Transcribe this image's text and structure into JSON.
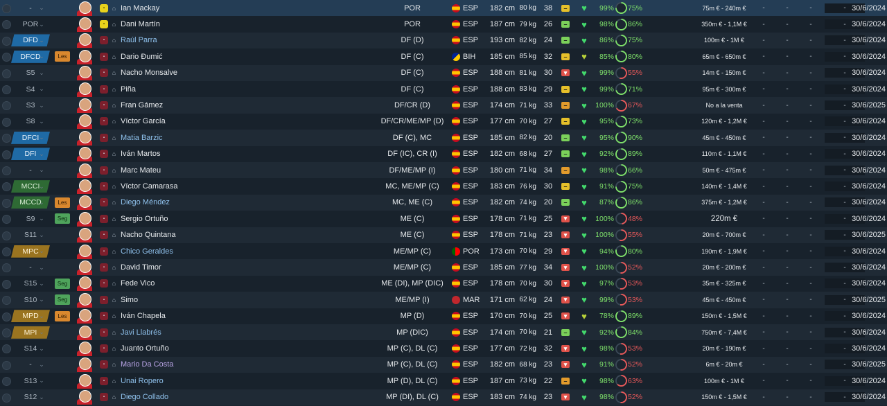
{
  "colors": {
    "condition_good": "#7ee06a",
    "sharpness_high": "#7ee06a",
    "sharpness_low": "#e8595a",
    "link_name": "#8fc1ec",
    "loan_name": "#b9a4e6"
  },
  "players": [
    {
      "pos": "-",
      "pos_style": "none",
      "role": "",
      "name": "Ian Mackay",
      "name_style": "normal",
      "shirt": "yellow",
      "position": "POR",
      "nat": "ESP",
      "flag": "esp",
      "height": "182 cm",
      "weight": "80 kg",
      "age": "38",
      "morale": "yellow",
      "morale_glyph": "–",
      "heart": "green",
      "condition": "99%",
      "sharpness": "75%",
      "sharp_pct": 75,
      "sharp_level": "high",
      "value": "75m € - 240m €",
      "value_big": false,
      "dash_box": "-",
      "expiry": "30/6/2024"
    },
    {
      "pos": "POR",
      "pos_style": "none",
      "role": "",
      "name": "Dani Martín",
      "name_style": "normal",
      "shirt": "yellow",
      "position": "POR",
      "nat": "ESP",
      "flag": "esp",
      "height": "187 cm",
      "weight": "79 kg",
      "age": "26",
      "morale": "green",
      "morale_glyph": "–",
      "heart": "green",
      "condition": "98%",
      "sharpness": "86%",
      "sharp_pct": 86,
      "sharp_level": "high",
      "value": "350m € - 1,1M €",
      "value_big": false,
      "dash_box": "-",
      "expiry": "30/6/2024"
    },
    {
      "pos": "DFD",
      "pos_style": "blue",
      "role": "",
      "name": "Raúl Parra",
      "name_style": "link",
      "shirt": "red",
      "position": "DF (D)",
      "nat": "ESP",
      "flag": "esp",
      "height": "193 cm",
      "weight": "82 kg",
      "age": "24",
      "morale": "green",
      "morale_glyph": "–",
      "heart": "green",
      "condition": "86%",
      "sharpness": "75%",
      "sharp_pct": 75,
      "sharp_level": "high",
      "value": "100m € - 1M €",
      "value_big": false,
      "dash_box": "-",
      "expiry": "30/6/2024"
    },
    {
      "pos": "DFCD",
      "pos_style": "blue",
      "role": "Les",
      "role_style": "orange",
      "name": "Dario Đumić",
      "name_style": "normal",
      "shirt": "red",
      "position": "DF (C)",
      "nat": "BIH",
      "flag": "bih",
      "height": "185 cm",
      "weight": "85 kg",
      "age": "32",
      "morale": "yellow",
      "morale_glyph": "–",
      "heart": "yellow",
      "condition": "85%",
      "sharpness": "80%",
      "sharp_pct": 80,
      "sharp_level": "high",
      "value": "65m € - 650m €",
      "value_big": false,
      "dash_box": "-",
      "expiry": "30/6/2024"
    },
    {
      "pos": "S5",
      "pos_style": "none",
      "role": "",
      "name": "Nacho Monsalve",
      "name_style": "normal",
      "shirt": "red",
      "position": "DF (C)",
      "nat": "ESP",
      "flag": "esp",
      "height": "188 cm",
      "weight": "81 kg",
      "age": "30",
      "morale": "red",
      "morale_glyph": "▾",
      "heart": "green",
      "condition": "99%",
      "sharpness": "55%",
      "sharp_pct": 55,
      "sharp_level": "low",
      "value": "14m € - 150m €",
      "value_big": false,
      "dash_box": "-",
      "expiry": "30/6/2024"
    },
    {
      "pos": "S4",
      "pos_style": "none",
      "role": "",
      "name": "Piña",
      "name_style": "normal",
      "shirt": "red",
      "position": "DF (C)",
      "nat": "ESP",
      "flag": "esp",
      "height": "188 cm",
      "weight": "83 kg",
      "age": "29",
      "morale": "yellow",
      "morale_glyph": "–",
      "heart": "green",
      "condition": "99%",
      "sharpness": "71%",
      "sharp_pct": 71,
      "sharp_level": "high",
      "value": "95m € - 300m €",
      "value_big": false,
      "dash_box": "-",
      "expiry": "30/6/2024"
    },
    {
      "pos": "S3",
      "pos_style": "none",
      "role": "",
      "name": "Fran Gámez",
      "name_style": "normal",
      "shirt": "red",
      "position": "DF/CR (D)",
      "nat": "ESP",
      "flag": "esp",
      "height": "174 cm",
      "weight": "71 kg",
      "age": "33",
      "morale": "orange",
      "morale_glyph": "–",
      "heart": "green",
      "condition": "100%",
      "sharpness": "67%",
      "sharp_pct": 67,
      "sharp_level": "low",
      "value": "No a la venta",
      "value_big": false,
      "dash_box": "-",
      "expiry": "30/6/2025"
    },
    {
      "pos": "S8",
      "pos_style": "none",
      "role": "",
      "name": "Víctor García",
      "name_style": "normal",
      "shirt": "red",
      "position": "DF/CR/ME/MP (D)",
      "nat": "ESP",
      "flag": "esp",
      "height": "177 cm",
      "weight": "70 kg",
      "age": "27",
      "morale": "yellow",
      "morale_glyph": "–",
      "heart": "green",
      "condition": "95%",
      "sharpness": "73%",
      "sharp_pct": 73,
      "sharp_level": "high",
      "value": "120m € - 1,2M €",
      "value_big": false,
      "dash_box": "-",
      "expiry": "30/6/2024"
    },
    {
      "pos": "DFCI",
      "pos_style": "blue",
      "role": "",
      "name": "Matia Barzic",
      "name_style": "link",
      "shirt": "red",
      "position": "DF (C), MC",
      "nat": "ESP",
      "flag": "esp",
      "height": "185 cm",
      "weight": "82 kg",
      "age": "20",
      "morale": "green",
      "morale_glyph": "–",
      "heart": "green",
      "condition": "95%",
      "sharpness": "90%",
      "sharp_pct": 90,
      "sharp_level": "high",
      "value": "45m € - 450m €",
      "value_big": false,
      "dash_box": "-",
      "expiry": "30/6/2024"
    },
    {
      "pos": "DFI",
      "pos_style": "blue",
      "role": "",
      "name": "Iván Martos",
      "name_style": "normal",
      "shirt": "red",
      "position": "DF (IC), CR (I)",
      "nat": "ESP",
      "flag": "esp",
      "height": "182 cm",
      "weight": "68 kg",
      "age": "27",
      "morale": "green",
      "morale_glyph": "–",
      "heart": "green",
      "condition": "92%",
      "sharpness": "89%",
      "sharp_pct": 89,
      "sharp_level": "high",
      "value": "110m € - 1,1M €",
      "value_big": false,
      "dash_box": "-",
      "expiry": "30/6/2024"
    },
    {
      "pos": "-",
      "pos_style": "none",
      "role": "",
      "name": "Marc Mateu",
      "name_style": "normal",
      "shirt": "red",
      "position": "DF/ME/MP (I)",
      "nat": "ESP",
      "flag": "esp",
      "height": "180 cm",
      "weight": "71 kg",
      "age": "34",
      "morale": "orange",
      "morale_glyph": "–",
      "heart": "green",
      "condition": "98%",
      "sharpness": "66%",
      "sharp_pct": 66,
      "sharp_level": "high",
      "value": "50m € - 475m €",
      "value_big": false,
      "dash_box": "-",
      "expiry": "30/6/2024"
    },
    {
      "pos": "MCCI",
      "pos_style": "green",
      "role": "",
      "name": "Víctor Camarasa",
      "name_style": "normal",
      "shirt": "red",
      "position": "MC, ME/MP (C)",
      "nat": "ESP",
      "flag": "esp",
      "height": "183 cm",
      "weight": "76 kg",
      "age": "30",
      "morale": "yellow",
      "morale_glyph": "–",
      "heart": "green",
      "condition": "91%",
      "sharpness": "75%",
      "sharp_pct": 75,
      "sharp_level": "high",
      "value": "140m € - 1,4M €",
      "value_big": false,
      "dash_box": "-",
      "expiry": "30/6/2024"
    },
    {
      "pos": "MCCD",
      "pos_style": "green",
      "role": "Les",
      "role_style": "orange",
      "name": "Diego Méndez",
      "name_style": "link",
      "shirt": "red",
      "position": "MC, ME (C)",
      "nat": "ESP",
      "flag": "esp",
      "height": "182 cm",
      "weight": "74 kg",
      "age": "20",
      "morale": "green",
      "morale_glyph": "–",
      "heart": "green",
      "condition": "87%",
      "sharpness": "86%",
      "sharp_pct": 86,
      "sharp_level": "high",
      "value": "375m € - 1,2M €",
      "value_big": false,
      "dash_box": "-",
      "expiry": "30/6/2024"
    },
    {
      "pos": "S9",
      "pos_style": "none",
      "role": "Seg",
      "role_style": "green",
      "name": "Sergio Ortuño",
      "name_style": "normal",
      "shirt": "red",
      "position": "ME (C)",
      "nat": "ESP",
      "flag": "esp",
      "height": "178 cm",
      "weight": "71 kg",
      "age": "25",
      "morale": "red",
      "morale_glyph": "▾",
      "heart": "green",
      "condition": "100%",
      "sharpness": "48%",
      "sharp_pct": 48,
      "sharp_level": "low",
      "value": "220m €",
      "value_big": true,
      "dash_box": "-",
      "expiry": "30/6/2024"
    },
    {
      "pos": "S11",
      "pos_style": "none",
      "role": "",
      "name": "Nacho Quintana",
      "name_style": "normal",
      "shirt": "red",
      "position": "ME (C)",
      "nat": "ESP",
      "flag": "esp",
      "height": "178 cm",
      "weight": "71 kg",
      "age": "23",
      "morale": "red",
      "morale_glyph": "▾",
      "heart": "green",
      "condition": "100%",
      "sharpness": "55%",
      "sharp_pct": 55,
      "sharp_level": "low",
      "value": "20m € - 700m €",
      "value_big": false,
      "dash_box": "-",
      "expiry": "30/6/2025"
    },
    {
      "pos": "MPC",
      "pos_style": "gold",
      "role": "",
      "name": "Chico Geraldes",
      "name_style": "link",
      "shirt": "red",
      "position": "ME/MP (C)",
      "nat": "POR",
      "flag": "por",
      "height": "173 cm",
      "weight": "70 kg",
      "age": "29",
      "morale": "red",
      "morale_glyph": "▾",
      "heart": "green",
      "condition": "94%",
      "sharpness": "80%",
      "sharp_pct": 80,
      "sharp_level": "high",
      "value": "190m € - 1,9M €",
      "value_big": false,
      "dash_box": "-",
      "expiry": "30/6/2024"
    },
    {
      "pos": "-",
      "pos_style": "none",
      "role": "",
      "name": "David Timor",
      "name_style": "normal",
      "shirt": "red",
      "position": "ME/MP (C)",
      "nat": "ESP",
      "flag": "esp",
      "height": "185 cm",
      "weight": "77 kg",
      "age": "34",
      "morale": "red",
      "morale_glyph": "▾",
      "heart": "green",
      "condition": "100%",
      "sharpness": "52%",
      "sharp_pct": 52,
      "sharp_level": "low",
      "value": "20m € - 200m €",
      "value_big": false,
      "dash_box": "-",
      "expiry": "30/6/2024"
    },
    {
      "pos": "S15",
      "pos_style": "none",
      "role": "Seg",
      "role_style": "green",
      "name": "Fede Vico",
      "name_style": "normal",
      "shirt": "red",
      "position": "ME (DI), MP (DIC)",
      "nat": "ESP",
      "flag": "esp",
      "height": "178 cm",
      "weight": "70 kg",
      "age": "30",
      "morale": "red",
      "morale_glyph": "▾",
      "heart": "green",
      "condition": "97%",
      "sharpness": "53%",
      "sharp_pct": 53,
      "sharp_level": "low",
      "value": "35m € - 325m €",
      "value_big": false,
      "dash_box": "-",
      "expiry": "30/6/2024"
    },
    {
      "pos": "S10",
      "pos_style": "none",
      "role": "Seg",
      "role_style": "green",
      "name": "Simo",
      "name_style": "normal",
      "shirt": "red",
      "position": "ME/MP (I)",
      "nat": "MAR",
      "flag": "mar",
      "height": "171 cm",
      "weight": "62 kg",
      "age": "24",
      "morale": "red",
      "morale_glyph": "▾",
      "heart": "green",
      "condition": "99%",
      "sharpness": "53%",
      "sharp_pct": 53,
      "sharp_level": "low",
      "value": "45m € - 450m €",
      "value_big": false,
      "dash_box": "-",
      "expiry": "30/6/2025"
    },
    {
      "pos": "MPD",
      "pos_style": "gold",
      "role": "Les",
      "role_style": "orange",
      "name": "Iván Chapela",
      "name_style": "normal",
      "shirt": "red",
      "position": "MP (D)",
      "nat": "ESP",
      "flag": "esp",
      "height": "170 cm",
      "weight": "70 kg",
      "age": "25",
      "morale": "red",
      "morale_glyph": "▾",
      "heart": "yellow",
      "condition": "78%",
      "sharpness": "89%",
      "sharp_pct": 89,
      "sharp_level": "high",
      "value": "150m € - 1,5M €",
      "value_big": false,
      "dash_box": "-",
      "expiry": "30/6/2024"
    },
    {
      "pos": "MPI",
      "pos_style": "gold",
      "role": "",
      "name": "Javi Llabrés",
      "name_style": "link",
      "shirt": "red",
      "position": "MP (DIC)",
      "nat": "ESP",
      "flag": "esp",
      "height": "174 cm",
      "weight": "70 kg",
      "age": "21",
      "morale": "green",
      "morale_glyph": "–",
      "heart": "green",
      "condition": "92%",
      "sharpness": "84%",
      "sharp_pct": 84,
      "sharp_level": "high",
      "value": "750m € - 7,4M €",
      "value_big": false,
      "dash_box": "-",
      "expiry": "30/6/2024"
    },
    {
      "pos": "S14",
      "pos_style": "none",
      "role": "",
      "name": "Juanto Ortuño",
      "name_style": "normal",
      "shirt": "red",
      "position": "MP (C), DL (C)",
      "nat": "ESP",
      "flag": "esp",
      "height": "177 cm",
      "weight": "72 kg",
      "age": "32",
      "morale": "red",
      "morale_glyph": "▾",
      "heart": "green",
      "condition": "98%",
      "sharpness": "53%",
      "sharp_pct": 53,
      "sharp_level": "low",
      "value": "20m € - 190m €",
      "value_big": false,
      "dash_box": "-",
      "expiry": "30/6/2024"
    },
    {
      "pos": "-",
      "pos_style": "none",
      "role": "",
      "name": "Mario Da Costa",
      "name_style": "loan",
      "shirt": "red",
      "position": "MP (C), DL (C)",
      "nat": "ESP",
      "flag": "esp",
      "height": "182 cm",
      "weight": "68 kg",
      "age": "23",
      "morale": "red",
      "morale_glyph": "▾",
      "heart": "green",
      "condition": "91%",
      "sharpness": "52%",
      "sharp_pct": 52,
      "sharp_level": "low",
      "value": "6m € - 20m €",
      "value_big": false,
      "dash_box": "-",
      "expiry": "30/6/2025"
    },
    {
      "pos": "S13",
      "pos_style": "none",
      "role": "",
      "name": "Unai Ropero",
      "name_style": "link",
      "shirt": "red",
      "position": "MP (D), DL (C)",
      "nat": "ESP",
      "flag": "esp",
      "height": "187 cm",
      "weight": "73 kg",
      "age": "22",
      "morale": "orange",
      "morale_glyph": "–",
      "heart": "green",
      "condition": "98%",
      "sharpness": "63%",
      "sharp_pct": 63,
      "sharp_level": "low",
      "value": "100m € - 1M €",
      "value_big": false,
      "dash_box": "-",
      "expiry": "30/6/2024"
    },
    {
      "pos": "S12",
      "pos_style": "none",
      "role": "",
      "name": "Diego Collado",
      "name_style": "link",
      "shirt": "red",
      "position": "MP (DI), DL (C)",
      "nat": "ESP",
      "flag": "esp",
      "height": "183 cm",
      "weight": "74 kg",
      "age": "23",
      "morale": "red",
      "morale_glyph": "▾",
      "heart": "green",
      "condition": "98%",
      "sharpness": "52%",
      "sharp_pct": 52,
      "sharp_level": "low",
      "value": "150m € - 1,5M €",
      "value_big": false,
      "dash_box": "-",
      "expiry": "30/6/2024"
    }
  ]
}
